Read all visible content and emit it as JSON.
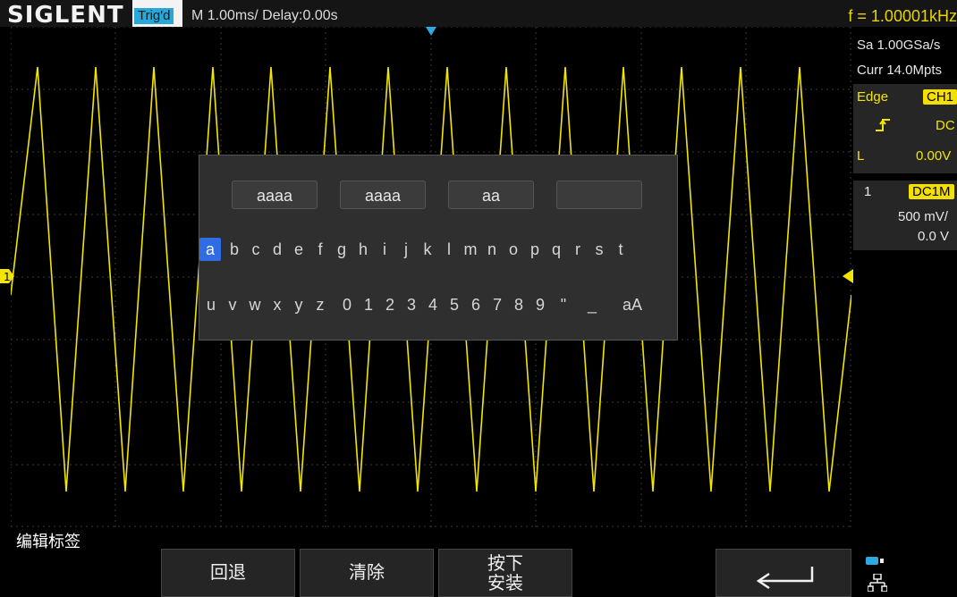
{
  "header": {
    "brand": "SIGLENT",
    "trig_status": "Trig'd",
    "timebase": "M 1.00ms/ Delay:0.00s",
    "frequency": "f = 1.00001kHz"
  },
  "acquisition": {
    "sample_rate": "Sa 1.00GSa/s",
    "memory_depth": "Curr 14.0Mpts"
  },
  "trigger": {
    "type": "Edge",
    "source": "CH1",
    "slope_icon": "rising-edge-icon",
    "coupling": "DC",
    "level_label": "L",
    "level": "0.00V"
  },
  "channel1": {
    "number": "1",
    "coupling_impedance": "DC1M",
    "scale": "500 mV/",
    "offset": "0.0 V",
    "marker": "1",
    "color": "#f2e600"
  },
  "keyboard": {
    "fields": [
      "aaaa",
      "aaaa",
      "aa",
      ""
    ],
    "row1": [
      "a",
      "b",
      "c",
      "d",
      "e",
      "f",
      "g",
      "h",
      "i",
      "j",
      "k",
      "l",
      "m",
      "n",
      "o",
      "p",
      "q",
      "r",
      "s",
      "t"
    ],
    "row2": [
      "u",
      "v",
      "w",
      "x",
      "y",
      "z",
      "0",
      "1",
      "2",
      "3",
      "4",
      "5",
      "6",
      "7",
      "8",
      "9",
      "\"",
      "_",
      "aA"
    ],
    "selected_key": "a",
    "selection_color": "#2f6ce6"
  },
  "menu": {
    "title": "编辑标签",
    "buttons": [
      "回退",
      "清除",
      "按下\n安装",
      "",
      ""
    ],
    "back_icon": "return-arrow-icon",
    "network_icon": "network-icon"
  }
}
